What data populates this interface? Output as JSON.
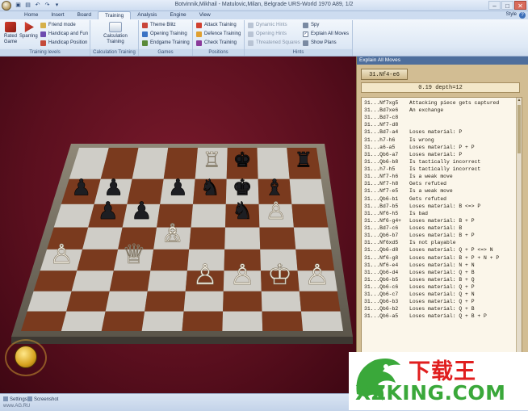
{
  "title": "Botvinnik,Mikhail - Matulovic,Milan, Belgrade URS-World 1970  A89, 1/2",
  "window_controls": [
    "–",
    "□",
    "✕"
  ],
  "tabs": [
    "Home",
    "Insert",
    "Board",
    "Training",
    "Analysis",
    "Engine",
    "View"
  ],
  "active_tab": "Training",
  "style_label": "Style",
  "ribbon": {
    "training_levels": {
      "label": "Training levels",
      "rated_game": "Rated Game",
      "sparring": "Sparring",
      "friend_mode": "Friend mode",
      "handicap_and_fun": "Handicap and Fun",
      "handicap_position": "Handicap Position"
    },
    "calculation": {
      "label": "Calculation Training",
      "button": "Calculation Training"
    },
    "games": {
      "label": "Games",
      "theme_blitz": "Theme Blitz",
      "opening_training": "Opening Training",
      "endgame_training": "Endgame Training"
    },
    "positions": {
      "label": "Positions",
      "attack_training": "Attack Training",
      "defence_training": "Defence Training",
      "check_training": "Check Training"
    },
    "hints": {
      "label": "Hints",
      "dynamic_hints": "Dynamic Hints",
      "opening_hints": "Opening Hints",
      "threatened_squares": "Threatened Squares",
      "spy": "Spy",
      "explain_all_moves": "Explain All Moves",
      "show_plans": "Show Plans"
    }
  },
  "panel": {
    "title": "Explain All Moves",
    "current_move": "31.Nf4-e6",
    "eval": "0.19 depth=12",
    "moves": [
      {
        "move": "31...Nf7xg5",
        "text": "Attacking piece gets captured"
      },
      {
        "move": "31...Bd7xe6",
        "text": "An exchange"
      },
      {
        "move": "31...Bd7-c8",
        "text": ""
      },
      {
        "move": "31...Nf7-d8",
        "text": ""
      },
      {
        "move": "31...Bd7-a4",
        "text": "Loses material: P"
      },
      {
        "move": "31...h7-h6",
        "text": "Is wrong"
      },
      {
        "move": "31...a6-a5",
        "text": "Loses material: P + P"
      },
      {
        "move": "31...Qb6-a7",
        "text": "Loses material: P"
      },
      {
        "move": "31...Qb6-b8",
        "text": "Is tactically incorrect"
      },
      {
        "move": "31...h7-h5",
        "text": "Is tactically incorrect"
      },
      {
        "move": "31...Nf7-h6",
        "text": "Is a weak move"
      },
      {
        "move": "31...Nf7-h8",
        "text": "Gets refuted"
      },
      {
        "move": "31...Nf7-e5",
        "text": "Is a weak move"
      },
      {
        "move": "31...Qb6-b1",
        "text": "Gets refuted"
      },
      {
        "move": "31...Bd7-b5",
        "text": "Loses material: B <=> P"
      },
      {
        "move": "31...Nf6-h5",
        "text": "Is bad"
      },
      {
        "move": "31...Nf6-g4+",
        "text": "Loses material: B + P"
      },
      {
        "move": "31...Bd7-c6",
        "text": "Loses material: B"
      },
      {
        "move": "31...Qb6-b7",
        "text": "Loses material: B + P"
      },
      {
        "move": "31...Nf6xd5",
        "text": "Is not playable"
      },
      {
        "move": "31...Qb6-d8",
        "text": "Loses material: Q + P <=> N"
      },
      {
        "move": "31...Nf6-g8",
        "text": "Loses material: B + P + N + P"
      },
      {
        "move": "31...Nf6-e4",
        "text": "Loses material: N + N"
      },
      {
        "move": "31...Qb6-d4",
        "text": "Loses material: Q + B"
      },
      {
        "move": "31...Qb6-b5",
        "text": "Loses material: B + Q"
      },
      {
        "move": "31...Qb6-c6",
        "text": "Loses material: Q + P"
      },
      {
        "move": "31...Qb6-c7",
        "text": "Loses material: Q + N"
      },
      {
        "move": "31...Qb6-b3",
        "text": "Loses material: Q + P"
      },
      {
        "move": "31...Qb6-b2",
        "text": "Loses material: Q + B"
      },
      {
        "move": "31...Qb6-a5",
        "text": "Loses material: Q + B + P"
      }
    ]
  },
  "statusbar": {
    "settings": "Settings",
    "screenshot": "Screenshot",
    "url": "www.AG.RU"
  },
  "watermark": {
    "top": "下载王",
    "bottom": "XZKING.COM"
  },
  "colors": {
    "board_background": "#5a0f1e",
    "panel_background": "#d2bd93",
    "light_square": "#cfcdc7",
    "dark_square": "#7a3a1e"
  },
  "board_pieces": {
    "light": [
      "♔",
      "♕",
      "♖",
      "♗",
      "♘",
      "♙"
    ],
    "dark": [
      "♚",
      "♛",
      "♜",
      "♝",
      "♞",
      "♟"
    ]
  }
}
